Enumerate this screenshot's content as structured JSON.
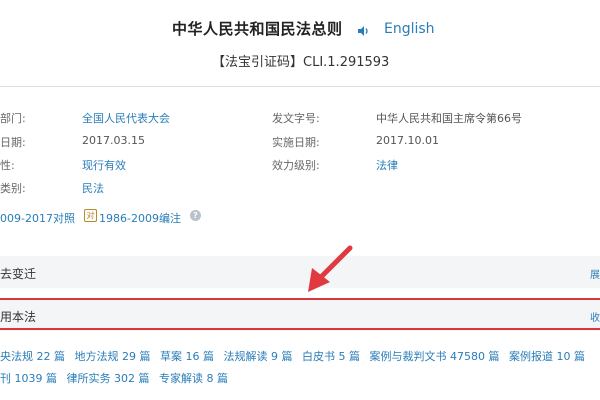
{
  "header": {
    "title": "中华人民共和国民法总则",
    "speaker_icon": "speaker-icon",
    "language_link": "English",
    "citation_code": "【法宝引证码】CLI.1.291593"
  },
  "info": {
    "left": [
      {
        "label": "部门:",
        "value": "全国人民代表大会",
        "link": true
      },
      {
        "label": "日期:",
        "value": "2017.03.15",
        "link": false
      },
      {
        "label": "性:",
        "value": "现行有效",
        "link": true
      },
      {
        "label": "类别:",
        "value": "民法",
        "link": true
      }
    ],
    "right": [
      {
        "label": "发文字号:",
        "value": "中华人民共和国主席令第66号",
        "link": false
      },
      {
        "label": "实施日期:",
        "value": "2017.10.01",
        "link": false
      },
      {
        "label": "效力级别:",
        "value": "法律",
        "link": true
      }
    ],
    "version_links": [
      "009-2017对照",
      "1986-2009编注"
    ],
    "version_icon": "compare-icon",
    "help_icon": "help-icon"
  },
  "sections": {
    "history": {
      "title": "去变迁",
      "action": "展"
    },
    "related": {
      "title": "用本法",
      "action": "收"
    }
  },
  "related_items": {
    "row1": [
      "央法规 22 篇",
      "地方法规 29 篇",
      "草案 16 篇",
      "法规解读 9 篇",
      "白皮书 5 篇",
      "案例与裁判文书 47580 篇",
      "案例报道 10 篇"
    ],
    "row2": [
      "刊 1039 篇",
      "律所实务 302 篇",
      "专家解读 8 篇"
    ]
  },
  "colors": {
    "link": "#2a7db8",
    "highlight": "#d9363e",
    "arrow": "#e0393f",
    "section_bg": "#f3f5f7"
  }
}
